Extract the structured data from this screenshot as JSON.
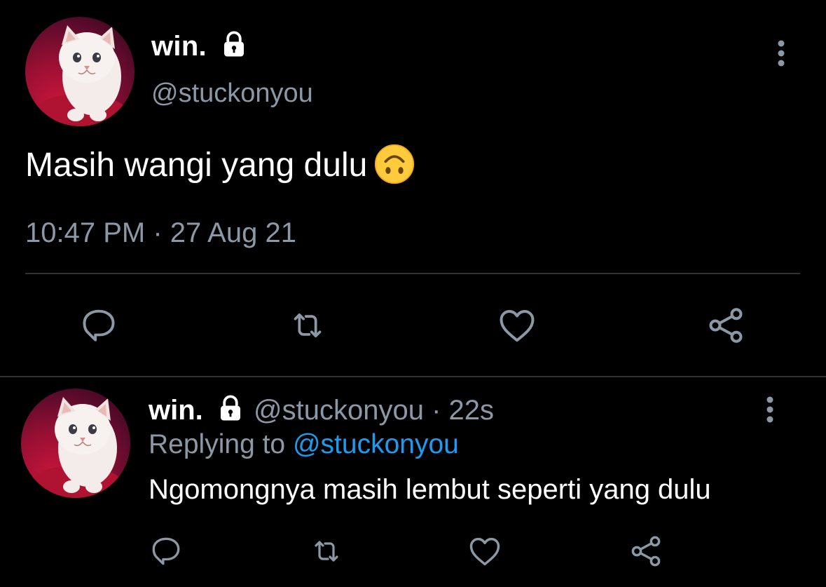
{
  "main_tweet": {
    "display_name": "win.",
    "handle": "@stuckonyou",
    "text": "Masih wangi yang dulu",
    "emoji": "upside-down-face",
    "timestamp": "10:47 PM · 27 Aug 21",
    "actions": [
      "reply-icon",
      "retweet-icon",
      "like-icon",
      "share-icon"
    ]
  },
  "reply_tweet": {
    "display_name": "win.",
    "handle": "@stuckonyou",
    "separator": "·",
    "age": "22s",
    "replying_label": "Replying to",
    "replying_to": "@stuckonyou",
    "text": "Ngomongnya masih lembut seperti yang dulu",
    "actions": [
      "reply-icon",
      "retweet-icon",
      "like-icon",
      "share-icon"
    ]
  },
  "colors": {
    "background": "#000000",
    "text_primary": "#ffffff",
    "text_secondary": "#8b98a5",
    "link": "#1d9bf0",
    "divider": "#2f3336",
    "icon": "#8b98a5"
  }
}
